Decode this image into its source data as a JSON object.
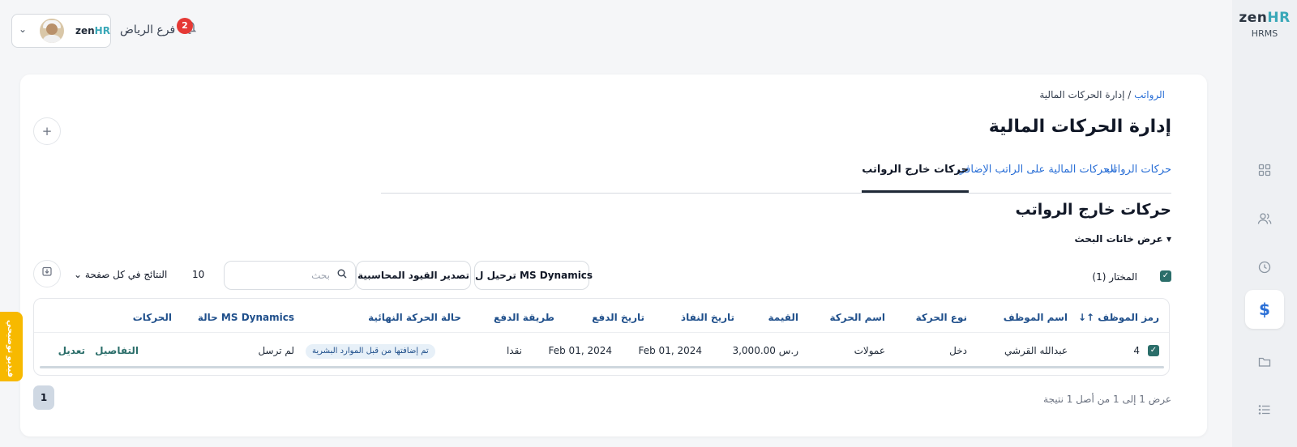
{
  "brand": {
    "name": "zen",
    "name_accent": "HR",
    "subtitle": "HRMS"
  },
  "header": {
    "branch": "فرع الرياض",
    "notifications": "2",
    "mini_logo": "zen",
    "mini_logo_accent": "HR"
  },
  "sidebar": {
    "items": [
      {
        "icon": "grid-icon"
      },
      {
        "icon": "users-icon"
      },
      {
        "icon": "clock-icon"
      },
      {
        "icon": "dollar-icon",
        "active": true
      },
      {
        "icon": "folder-icon"
      },
      {
        "icon": "list-icon"
      }
    ]
  },
  "breadcrumb": {
    "root": "الرواتب",
    "separator": "/",
    "current": "إدارة الحركات المالية"
  },
  "page": {
    "title": "إدارة الحركات المالية"
  },
  "tabs": [
    {
      "label": "حركات الرواتب"
    },
    {
      "label": "الحركات المالية على الراتب الإضافي"
    },
    {
      "label": "حركات خارج الرواتب",
      "active": true
    }
  ],
  "section": {
    "title": "حركات خارج الرواتب",
    "search_toggle": "عرض خانات البحث"
  },
  "toolbar": {
    "selected_label": "المختار (1)",
    "ms_button": "ترحيل ل MS Dynamics",
    "export_entries_button": "تصدير القيود المحاسبية",
    "search_placeholder": "بحث",
    "per_page": "10",
    "per_page_label": "النتائج في كل صفحة"
  },
  "table": {
    "headers": [
      "رمز الموظف",
      "اسم الموظف",
      "نوع الحركة",
      "اسم الحركة",
      "القيمة",
      "تاريخ النفاذ",
      "تاريخ الدفع",
      "طريقة الدفع",
      "حالة الحركة النهائية",
      "حالة MS Dynamics",
      "الحركات"
    ],
    "rows": [
      {
        "code": "4",
        "name": "عبدالله القرشي",
        "type": "دخل",
        "transaction": "عمولات",
        "value": "3,000.00 ر.س",
        "effective_date": "Feb 01, 2024",
        "payment_date": "Feb 01, 2024",
        "payment_method": "نقدا",
        "final_status": "تم إضافتها من قبل الموارد البشرية",
        "ms_status": "لم ترسل",
        "details_link": "التفاصيل",
        "edit_link": "تعديل"
      }
    ]
  },
  "footer": {
    "summary": "عرض 1 إلى 1 من أصل 1 نتيجة",
    "page": "1"
  },
  "demo_tab": "فيديو توضيحي",
  "colors": {
    "accent": "#2a6fd6",
    "teal": "#2b6e6a",
    "badge": "#e53935",
    "demo": "#f7b900"
  }
}
